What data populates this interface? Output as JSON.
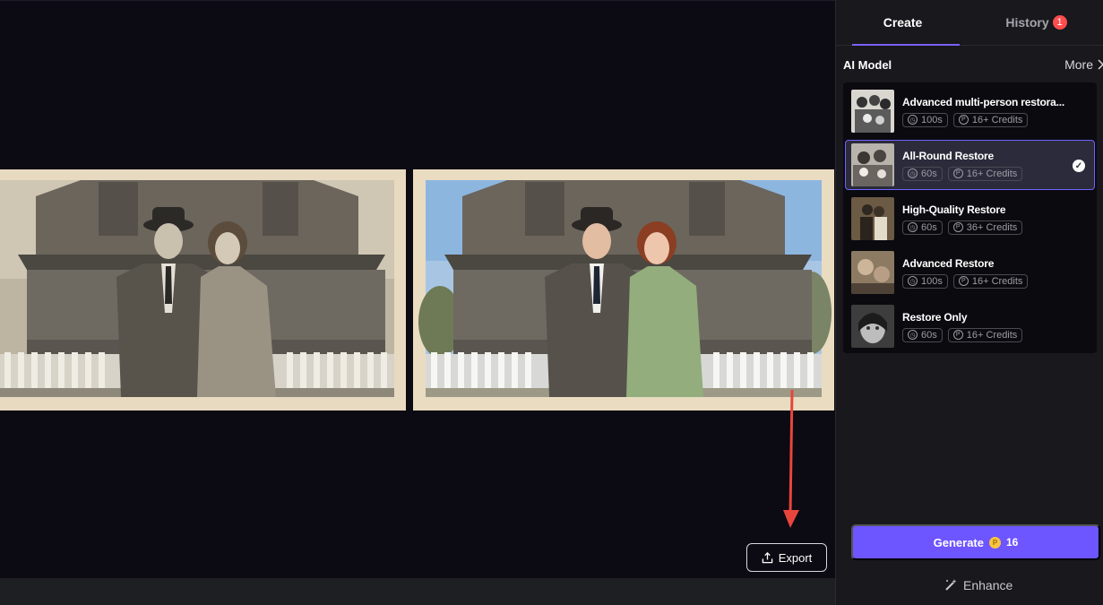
{
  "tabs": [
    {
      "label": "Create",
      "active": true
    },
    {
      "label": "History",
      "badge": "1"
    }
  ],
  "ai_model": {
    "title": "AI Model",
    "more_label": "More"
  },
  "models": [
    {
      "name": "Advanced multi-person restora...",
      "time": "100s",
      "credits": "16+ Credits",
      "selected": false
    },
    {
      "name": "All-Round Restore",
      "time": "60s",
      "credits": "16+ Credits",
      "selected": true
    },
    {
      "name": "High-Quality Restore",
      "time": "60s",
      "credits": "36+ Credits",
      "selected": false
    },
    {
      "name": "Advanced Restore",
      "time": "100s",
      "credits": "16+ Credits",
      "selected": false
    },
    {
      "name": "Restore Only",
      "time": "60s",
      "credits": "16+ Credits",
      "selected": false
    }
  ],
  "generate": {
    "label": "Generate",
    "cost": "16"
  },
  "enhance_label": "Enhance",
  "export_label": "Export",
  "colors": {
    "accent": "#6d55ff",
    "selected_border": "#6e63ff",
    "badge": "#ff4d4f",
    "arrow": "#e8453c"
  },
  "icons": {
    "clock": "clock-icon",
    "credits": "credits-icon",
    "check": "check-icon",
    "export": "upload-icon",
    "enhance": "magic-wand-icon",
    "more": "chevron-right-icon"
  }
}
